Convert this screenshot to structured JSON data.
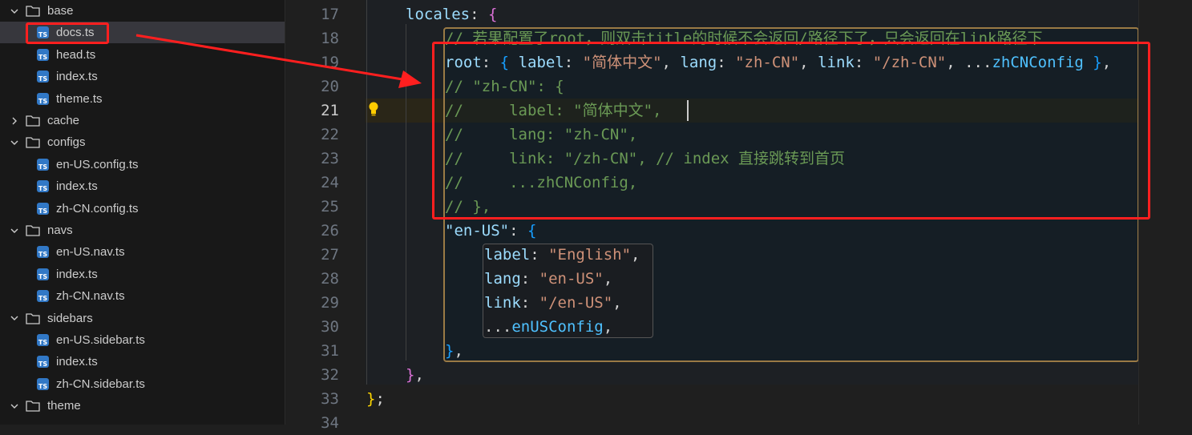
{
  "explorer": {
    "items": [
      {
        "kind": "folder",
        "label": "base",
        "expanded": true
      },
      {
        "kind": "file",
        "label": "docs.ts",
        "selected": true
      },
      {
        "kind": "file",
        "label": "head.ts"
      },
      {
        "kind": "file",
        "label": "index.ts"
      },
      {
        "kind": "file",
        "label": "theme.ts"
      },
      {
        "kind": "folder",
        "label": "cache",
        "expanded": false
      },
      {
        "kind": "folder",
        "label": "configs",
        "expanded": true
      },
      {
        "kind": "file",
        "label": "en-US.config.ts"
      },
      {
        "kind": "file",
        "label": "index.ts"
      },
      {
        "kind": "file",
        "label": "zh-CN.config.ts"
      },
      {
        "kind": "folder",
        "label": "navs",
        "expanded": true
      },
      {
        "kind": "file",
        "label": "en-US.nav.ts"
      },
      {
        "kind": "file",
        "label": "index.ts"
      },
      {
        "kind": "file",
        "label": "zh-CN.nav.ts"
      },
      {
        "kind": "folder",
        "label": "sidebars",
        "expanded": true
      },
      {
        "kind": "file",
        "label": "en-US.sidebar.ts"
      },
      {
        "kind": "file",
        "label": "index.ts"
      },
      {
        "kind": "file",
        "label": "zh-CN.sidebar.ts"
      },
      {
        "kind": "folder",
        "label": "theme",
        "expanded": true
      }
    ],
    "file_icon_text": "TS"
  },
  "editor": {
    "active_line": 21,
    "lines": [
      {
        "n": "17",
        "tokens": [
          [
            "k",
            "locales"
          ],
          [
            "p",
            ": "
          ],
          [
            "b1",
            "{"
          ]
        ]
      },
      {
        "n": "18",
        "tokens": [
          [
            "c",
            "// 若果配置了root，则双击title的时候不会返回/路径下了，只会返回在link路径下"
          ]
        ]
      },
      {
        "n": "19",
        "tokens": [
          [
            "k",
            "root"
          ],
          [
            "p",
            ": "
          ],
          [
            "b2",
            "{"
          ],
          [
            "p",
            " "
          ],
          [
            "k",
            "label"
          ],
          [
            "p",
            ": "
          ],
          [
            "s",
            "\"简体中文\""
          ],
          [
            "p",
            ", "
          ],
          [
            "k",
            "lang"
          ],
          [
            "p",
            ": "
          ],
          [
            "s",
            "\"zh-CN\""
          ],
          [
            "p",
            ", "
          ],
          [
            "k",
            "link"
          ],
          [
            "p",
            ": "
          ],
          [
            "s",
            "\"/zh-CN\""
          ],
          [
            "p",
            ", ..."
          ],
          [
            "id",
            "zhCNConfig"
          ],
          [
            "p",
            " "
          ],
          [
            "b2",
            "}"
          ],
          [
            "p",
            ","
          ]
        ]
      },
      {
        "n": "20",
        "tokens": [
          [
            "c",
            "// \"zh-CN\": {"
          ]
        ]
      },
      {
        "n": "21",
        "tokens": [
          [
            "c",
            "//     label: \"简体中文\","
          ]
        ]
      },
      {
        "n": "22",
        "tokens": [
          [
            "c",
            "//     lang: \"zh-CN\","
          ]
        ]
      },
      {
        "n": "23",
        "tokens": [
          [
            "c",
            "//     link: \"/zh-CN\", // index 直接跳转到首页"
          ]
        ]
      },
      {
        "n": "24",
        "tokens": [
          [
            "c",
            "//     ...zhCNConfig,"
          ]
        ]
      },
      {
        "n": "25",
        "tokens": [
          [
            "c",
            "// },"
          ]
        ]
      },
      {
        "n": "26",
        "tokens": [
          [
            "k",
            "\"en-US\""
          ],
          [
            "p",
            ": "
          ],
          [
            "b2",
            "{"
          ]
        ]
      },
      {
        "n": "27",
        "tokens": [
          [
            "k",
            "label"
          ],
          [
            "p",
            ": "
          ],
          [
            "s",
            "\"English\""
          ],
          [
            "p",
            ","
          ]
        ]
      },
      {
        "n": "28",
        "tokens": [
          [
            "k",
            "lang"
          ],
          [
            "p",
            ": "
          ],
          [
            "s",
            "\"en-US\""
          ],
          [
            "p",
            ","
          ]
        ]
      },
      {
        "n": "29",
        "tokens": [
          [
            "k",
            "link"
          ],
          [
            "p",
            ": "
          ],
          [
            "s",
            "\"/en-US\""
          ],
          [
            "p",
            ","
          ]
        ]
      },
      {
        "n": "30",
        "tokens": [
          [
            "p",
            "..."
          ],
          [
            "id",
            "enUSConfig"
          ],
          [
            "p",
            ","
          ]
        ]
      },
      {
        "n": "31",
        "tokens": [
          [
            "b2",
            "}"
          ],
          [
            "p",
            ","
          ]
        ]
      },
      {
        "n": "32",
        "tokens": [
          [
            "b1",
            "}"
          ],
          [
            "p",
            ","
          ]
        ]
      },
      {
        "n": "33",
        "tokens": [
          [
            "b3",
            "}"
          ],
          [
            "p",
            ";"
          ]
        ]
      },
      {
        "n": "34",
        "tokens": []
      }
    ]
  },
  "colors": {
    "highlight_red": "#ff1f1f",
    "ts_icon": "#3178c6",
    "scope_border": "#9a7a45"
  }
}
